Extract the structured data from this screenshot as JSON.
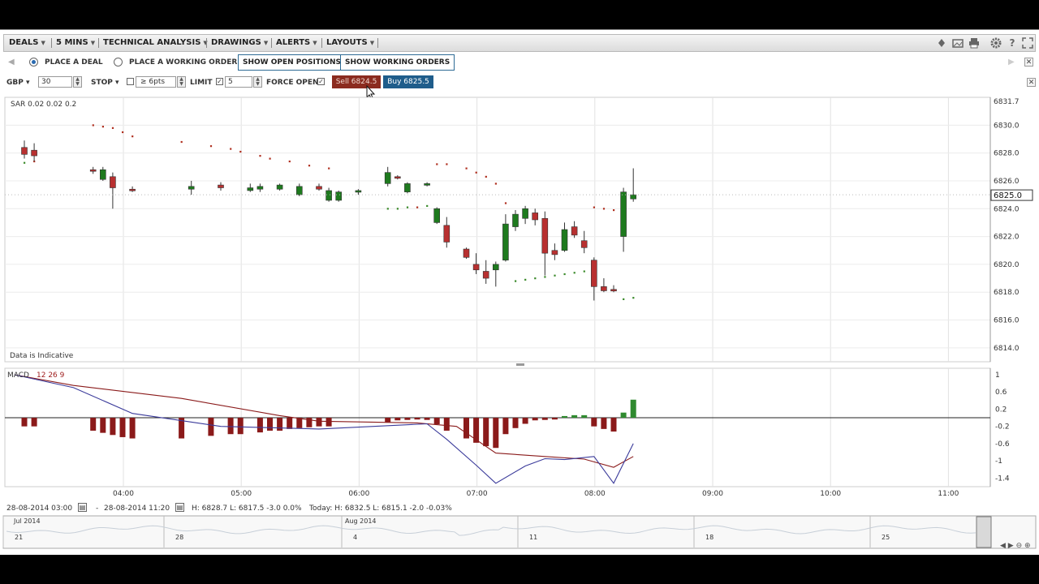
{
  "menu": {
    "deals": "DEALS",
    "timeframe": "5 MINS",
    "technical": "TECHNICAL ANALYSIS",
    "drawings": "DRAWINGS",
    "alerts": "ALERTS",
    "layouts": "LAYOUTS"
  },
  "toolbar_icons": [
    "lock-icon",
    "image-icon",
    "print-icon",
    "gear-icon",
    "help-icon",
    "fullscreen-icon"
  ],
  "deal_row": {
    "place_deal": "PLACE A DEAL",
    "place_working_order": "PLACE A WORKING ORDER",
    "show_open_positions": "SHOW OPEN POSITIONS",
    "show_working_orders": "SHOW WORKING ORDERS"
  },
  "ticket": {
    "currency": "GBP",
    "size_value": "30",
    "stop_label": "STOP",
    "stop_value": "≥ 6pts",
    "limit_label": "LIMIT",
    "limit_value": "5",
    "force_open": "FORCE OPEN",
    "sell": "Sell 6824.5",
    "buy": "Buy 6825.5",
    "sell_color": "#8b2b1f",
    "buy_color": "#1f5d8b"
  },
  "price_panel": {
    "indicator_label": "SAR  0.02  0.02  0.2",
    "footer_note": "Data is Indicative",
    "current_price": "6825.0",
    "axis_ticks": [
      "6831.7",
      "6830.0",
      "6828.0",
      "6826.0",
      "6824.0",
      "6822.0",
      "6820.0",
      "6818.0",
      "6816.0",
      "6814.0"
    ]
  },
  "macd_panel": {
    "label": "MACD",
    "params": "12  26  9",
    "axis_ticks": [
      "1",
      "0.6",
      "0.2",
      "-0.2",
      "-0.6",
      "-1",
      "-1.4"
    ]
  },
  "time_axis": [
    "04:00",
    "05:00",
    "06:00",
    "07:00",
    "08:00",
    "09:00",
    "10:00",
    "11:00"
  ],
  "status": {
    "from": "28-08-2014 03:00",
    "dash": "-",
    "to": "28-08-2014 11:20",
    "range": "H: 6828.7  L: 6817.5  -3.0  0.0%",
    "today": "Today: H: 6832.5  L: 6815.1  -2.0  -0.03%"
  },
  "navigator": {
    "month_labels": [
      "Jul 2014",
      "Aug 2014"
    ],
    "day_labels": [
      "21",
      "28",
      "4",
      "11",
      "18",
      "25"
    ]
  },
  "chart_data": {
    "type": "candlestick",
    "x_labels": [
      "04:00",
      "05:00",
      "06:00",
      "07:00",
      "08:00",
      "09:00",
      "10:00",
      "11:00"
    ],
    "ylim": [
      6813,
      6832
    ],
    "bull_color": "#1e7a1e",
    "bear_color": "#b83030",
    "candles": [
      {
        "i": 0,
        "o": 6828.4,
        "h": 6828.9,
        "l": 6827.6,
        "c": 6827.9
      },
      {
        "i": 1,
        "o": 6828.2,
        "h": 6828.7,
        "l": 6827.4,
        "c": 6827.8
      },
      {
        "i": 7,
        "o": 6826.8,
        "h": 6827.0,
        "l": 6826.5,
        "c": 6826.7
      },
      {
        "i": 8,
        "o": 6826.1,
        "h": 6827.0,
        "l": 6826.0,
        "c": 6826.8
      },
      {
        "i": 9,
        "o": 6826.3,
        "h": 6826.6,
        "l": 6824.0,
        "c": 6825.5
      },
      {
        "i": 11,
        "o": 6825.4,
        "h": 6825.6,
        "l": 6825.2,
        "c": 6825.3
      },
      {
        "i": 17,
        "o": 6825.4,
        "h": 6826.0,
        "l": 6825.0,
        "c": 6825.6
      },
      {
        "i": 20,
        "o": 6825.7,
        "h": 6825.9,
        "l": 6825.3,
        "c": 6825.5
      },
      {
        "i": 23,
        "o": 6825.3,
        "h": 6825.8,
        "l": 6825.2,
        "c": 6825.5
      },
      {
        "i": 24,
        "o": 6825.4,
        "h": 6825.8,
        "l": 6825.2,
        "c": 6825.6
      },
      {
        "i": 26,
        "o": 6825.4,
        "h": 6825.8,
        "l": 6825.3,
        "c": 6825.7
      },
      {
        "i": 28,
        "o": 6825.0,
        "h": 6825.8,
        "l": 6824.9,
        "c": 6825.6
      },
      {
        "i": 30,
        "o": 6825.6,
        "h": 6825.8,
        "l": 6825.3,
        "c": 6825.4
      },
      {
        "i": 31,
        "o": 6824.6,
        "h": 6825.5,
        "l": 6824.5,
        "c": 6825.3
      },
      {
        "i": 32,
        "o": 6824.6,
        "h": 6825.3,
        "l": 6824.5,
        "c": 6825.2
      },
      {
        "i": 34,
        "o": 6825.2,
        "h": 6825.4,
        "l": 6825.0,
        "c": 6825.3
      },
      {
        "i": 37,
        "o": 6825.8,
        "h": 6827.0,
        "l": 6825.6,
        "c": 6826.6
      },
      {
        "i": 38,
        "o": 6826.3,
        "h": 6826.4,
        "l": 6826.1,
        "c": 6826.2
      },
      {
        "i": 39,
        "o": 6825.2,
        "h": 6825.9,
        "l": 6825.1,
        "c": 6825.8
      },
      {
        "i": 41,
        "o": 6825.7,
        "h": 6825.9,
        "l": 6825.6,
        "c": 6825.8
      },
      {
        "i": 42,
        "o": 6823.0,
        "h": 6824.1,
        "l": 6822.9,
        "c": 6824.0
      },
      {
        "i": 43,
        "o": 6822.8,
        "h": 6823.4,
        "l": 6821.2,
        "c": 6821.6
      },
      {
        "i": 45,
        "o": 6821.1,
        "h": 6821.2,
        "l": 6820.4,
        "c": 6820.5
      },
      {
        "i": 46,
        "o": 6820.0,
        "h": 6820.8,
        "l": 6819.3,
        "c": 6819.6
      },
      {
        "i": 47,
        "o": 6819.5,
        "h": 6820.3,
        "l": 6818.6,
        "c": 6819.0
      },
      {
        "i": 48,
        "o": 6819.6,
        "h": 6820.2,
        "l": 6818.4,
        "c": 6820.0
      },
      {
        "i": 49,
        "o": 6820.3,
        "h": 6823.6,
        "l": 6820.2,
        "c": 6822.9
      },
      {
        "i": 50,
        "o": 6822.7,
        "h": 6823.9,
        "l": 6822.4,
        "c": 6823.6
      },
      {
        "i": 51,
        "o": 6823.3,
        "h": 6824.2,
        "l": 6822.9,
        "c": 6824.0
      },
      {
        "i": 52,
        "o": 6823.7,
        "h": 6824.0,
        "l": 6822.8,
        "c": 6823.2
      },
      {
        "i": 53,
        "o": 6823.3,
        "h": 6823.8,
        "l": 6819.2,
        "c": 6820.8
      },
      {
        "i": 54,
        "o": 6821.0,
        "h": 6821.5,
        "l": 6820.3,
        "c": 6820.7
      },
      {
        "i": 55,
        "o": 6821.0,
        "h": 6823.0,
        "l": 6820.9,
        "c": 6822.5
      },
      {
        "i": 56,
        "o": 6822.7,
        "h": 6823.1,
        "l": 6821.9,
        "c": 6822.1
      },
      {
        "i": 57,
        "o": 6821.7,
        "h": 6822.4,
        "l": 6820.8,
        "c": 6821.2
      },
      {
        "i": 58,
        "o": 6820.3,
        "h": 6820.5,
        "l": 6817.4,
        "c": 6818.4
      },
      {
        "i": 59,
        "o": 6818.4,
        "h": 6819.0,
        "l": 6818.0,
        "c": 6818.1
      },
      {
        "i": 60,
        "o": 6818.2,
        "h": 6818.5,
        "l": 6818.0,
        "c": 6818.1
      },
      {
        "i": 61,
        "o": 6822.0,
        "h": 6825.5,
        "l": 6820.9,
        "c": 6825.2
      },
      {
        "i": 62,
        "o": 6824.7,
        "h": 6826.9,
        "l": 6824.5,
        "c": 6825.0
      }
    ],
    "sar": [
      {
        "i": 0,
        "v": 6827.3
      },
      {
        "i": 1,
        "v": 6827.4
      },
      {
        "i": 7,
        "v": 6830.0
      },
      {
        "i": 8,
        "v": 6829.9
      },
      {
        "i": 9,
        "v": 6829.8
      },
      {
        "i": 10,
        "v": 6829.5
      },
      {
        "i": 11,
        "v": 6829.2
      },
      {
        "i": 16,
        "v": 6828.8
      },
      {
        "i": 19,
        "v": 6828.5
      },
      {
        "i": 21,
        "v": 6828.3
      },
      {
        "i": 22,
        "v": 6828.1
      },
      {
        "i": 24,
        "v": 6827.8
      },
      {
        "i": 25,
        "v": 6827.6
      },
      {
        "i": 27,
        "v": 6827.4
      },
      {
        "i": 29,
        "v": 6827.1
      },
      {
        "i": 31,
        "v": 6826.9
      },
      {
        "i": 37,
        "v": 6824.0
      },
      {
        "i": 38,
        "v": 6824.0
      },
      {
        "i": 39,
        "v": 6824.1
      },
      {
        "i": 40,
        "v": 6824.1
      },
      {
        "i": 41,
        "v": 6824.2
      },
      {
        "i": 42,
        "v": 6827.2
      },
      {
        "i": 43,
        "v": 6827.2
      },
      {
        "i": 45,
        "v": 6826.9
      },
      {
        "i": 46,
        "v": 6826.6
      },
      {
        "i": 47,
        "v": 6826.3
      },
      {
        "i": 48,
        "v": 6825.8
      },
      {
        "i": 49,
        "v": 6824.4
      },
      {
        "i": 50,
        "v": 6818.8
      },
      {
        "i": 51,
        "v": 6818.9
      },
      {
        "i": 52,
        "v": 6819.0
      },
      {
        "i": 53,
        "v": 6819.1
      },
      {
        "i": 54,
        "v": 6819.2
      },
      {
        "i": 55,
        "v": 6819.3
      },
      {
        "i": 56,
        "v": 6819.4
      },
      {
        "i": 57,
        "v": 6819.5
      },
      {
        "i": 58,
        "v": 6824.1
      },
      {
        "i": 59,
        "v": 6824.0
      },
      {
        "i": 60,
        "v": 6823.9
      },
      {
        "i": 61,
        "v": 6817.5
      },
      {
        "i": 62,
        "v": 6817.6
      }
    ],
    "macd_ylim": [
      -1.6,
      1.15
    ],
    "macd_hist": [
      {
        "i": 0,
        "v": -0.2
      },
      {
        "i": 1,
        "v": -0.2
      },
      {
        "i": 7,
        "v": -0.3
      },
      {
        "i": 8,
        "v": -0.35
      },
      {
        "i": 9,
        "v": -0.4
      },
      {
        "i": 10,
        "v": -0.45
      },
      {
        "i": 11,
        "v": -0.48
      },
      {
        "i": 16,
        "v": -0.48
      },
      {
        "i": 19,
        "v": -0.42
      },
      {
        "i": 21,
        "v": -0.38
      },
      {
        "i": 22,
        "v": -0.38
      },
      {
        "i": 24,
        "v": -0.34
      },
      {
        "i": 25,
        "v": -0.3
      },
      {
        "i": 26,
        "v": -0.3
      },
      {
        "i": 27,
        "v": -0.26
      },
      {
        "i": 28,
        "v": -0.24
      },
      {
        "i": 29,
        "v": -0.22
      },
      {
        "i": 30,
        "v": -0.2
      },
      {
        "i": 31,
        "v": -0.2
      },
      {
        "i": 37,
        "v": -0.1
      },
      {
        "i": 38,
        "v": -0.06
      },
      {
        "i": 39,
        "v": -0.05
      },
      {
        "i": 40,
        "v": -0.04
      },
      {
        "i": 41,
        "v": -0.05
      },
      {
        "i": 42,
        "v": -0.15
      },
      {
        "i": 43,
        "v": -0.3
      },
      {
        "i": 45,
        "v": -0.48
      },
      {
        "i": 46,
        "v": -0.58
      },
      {
        "i": 47,
        "v": -0.66
      },
      {
        "i": 48,
        "v": -0.7
      },
      {
        "i": 49,
        "v": -0.38
      },
      {
        "i": 50,
        "v": -0.24
      },
      {
        "i": 51,
        "v": -0.14
      },
      {
        "i": 52,
        "v": -0.06
      },
      {
        "i": 53,
        "v": -0.05
      },
      {
        "i": 54,
        "v": -0.04
      },
      {
        "i": 55,
        "v": 0.04
      },
      {
        "i": 56,
        "v": 0.06
      },
      {
        "i": 57,
        "v": 0.06
      },
      {
        "i": 58,
        "v": -0.2
      },
      {
        "i": 59,
        "v": -0.26
      },
      {
        "i": 60,
        "v": -0.32
      },
      {
        "i": 61,
        "v": 0.12
      },
      {
        "i": 62,
        "v": 0.42
      }
    ],
    "macd_line": [
      {
        "i": -1,
        "v": 1.0
      },
      {
        "i": 5,
        "v": 0.7
      },
      {
        "i": 11,
        "v": 0.1
      },
      {
        "i": 20,
        "v": -0.2
      },
      {
        "i": 30,
        "v": -0.26
      },
      {
        "i": 41,
        "v": -0.14
      },
      {
        "i": 43,
        "v": -0.5
      },
      {
        "i": 46,
        "v": -1.1
      },
      {
        "i": 48,
        "v": -1.52
      },
      {
        "i": 51,
        "v": -1.12
      },
      {
        "i": 53,
        "v": -0.95
      },
      {
        "i": 55,
        "v": -0.97
      },
      {
        "i": 58,
        "v": -0.9
      },
      {
        "i": 60,
        "v": -1.52
      },
      {
        "i": 62,
        "v": -0.6
      }
    ],
    "signal_line": [
      {
        "i": -1,
        "v": 1.0
      },
      {
        "i": 5,
        "v": 0.75
      },
      {
        "i": 16,
        "v": 0.45
      },
      {
        "i": 26,
        "v": 0.05
      },
      {
        "i": 30,
        "v": -0.08
      },
      {
        "i": 40,
        "v": -0.12
      },
      {
        "i": 44,
        "v": -0.2
      },
      {
        "i": 48,
        "v": -0.82
      },
      {
        "i": 53,
        "v": -0.9
      },
      {
        "i": 57,
        "v": -0.96
      },
      {
        "i": 60,
        "v": -1.15
      },
      {
        "i": 62,
        "v": -0.9
      }
    ],
    "macd_color": "#3a3a9a",
    "signal_color": "#8a1a1a"
  }
}
